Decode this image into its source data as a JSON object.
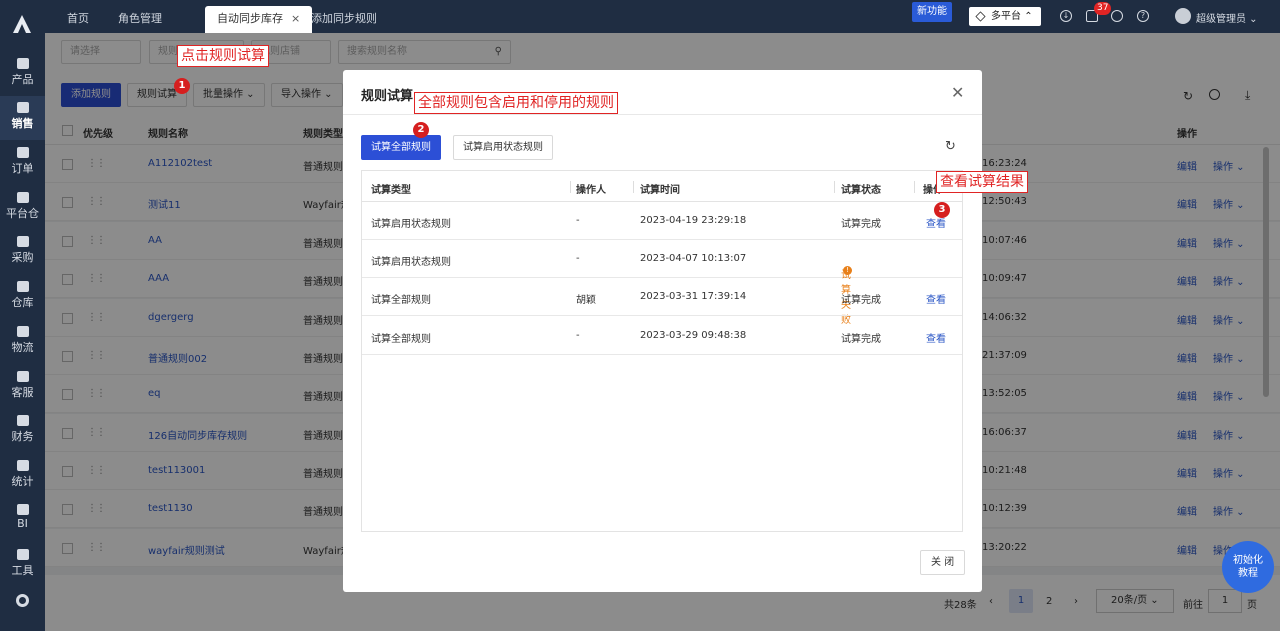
{
  "sidebar": {
    "items": [
      {
        "label": "产品"
      },
      {
        "label": "销售"
      },
      {
        "label": "订单"
      },
      {
        "label": "平台仓"
      },
      {
        "label": "采购"
      },
      {
        "label": "仓库"
      },
      {
        "label": "物流"
      },
      {
        "label": "客服"
      },
      {
        "label": "财务"
      },
      {
        "label": "统计"
      },
      {
        "label": "BI"
      },
      {
        "label": "工具"
      }
    ]
  },
  "topbar": {
    "tabs": [
      {
        "label": "首页"
      },
      {
        "label": "角色管理"
      },
      {
        "label": "自动同步库存"
      },
      {
        "label": "添加同步规则"
      }
    ],
    "new_feature": "新功能",
    "platform": "多平台",
    "notification_count": "37",
    "user": "超级管理员"
  },
  "filters": {
    "select1": "请选择",
    "select2": "规则类型",
    "select3": "规则店铺",
    "search_placeholder": "搜索规则名称"
  },
  "toolbar": {
    "add": "添加规则",
    "trial": "规则试算",
    "batch": "批量操作",
    "import": "导入操作"
  },
  "table": {
    "headers": {
      "priority": "优先级",
      "name": "规则名称",
      "type": "规则类型",
      "op": "操作"
    },
    "rows": [
      {
        "name": "A112102test",
        "type": "普通规则",
        "time": "16:23:24"
      },
      {
        "name": "测试11",
        "type": "Wayfair规",
        "time": "12:50:43"
      },
      {
        "name": "AA",
        "type": "普通规则",
        "time": "10:07:46"
      },
      {
        "name": "AAA",
        "type": "普通规则",
        "time": "10:09:47"
      },
      {
        "name": "dgergerg",
        "type": "普通规则",
        "time": "14:06:32"
      },
      {
        "name": "普通规则002",
        "type": "普通规则",
        "time": "21:37:09"
      },
      {
        "name": "eq",
        "type": "普通规则",
        "time": "13:52:05"
      },
      {
        "name": "126自动同步库存规则",
        "type": "普通规则",
        "time": "16:06:37"
      },
      {
        "name": "test113001",
        "type": "普通规则",
        "time": "10:21:48"
      },
      {
        "name": "test1130",
        "type": "普通规则",
        "time": "10:12:39"
      },
      {
        "name": "wayfair规则测试",
        "type": "Wayfair规",
        "time": "13:20:22"
      }
    ],
    "edit_label": "编辑",
    "op_label": "操作"
  },
  "pagination": {
    "total": "共28条",
    "page1": "1",
    "page2": "2",
    "page_size": "20条/页",
    "goto_label": "前往",
    "goto_value": "1",
    "page_suffix": "页"
  },
  "modal": {
    "title": "规则试算",
    "btn_all": "试算全部规则",
    "btn_enabled": "试算启用状态规则",
    "headers": {
      "type": "试算类型",
      "operator": "操作人",
      "time": "试算时间",
      "status": "试算状态",
      "op": "操作"
    },
    "rows": [
      {
        "type": "试算启用状态规则",
        "operator": "-",
        "time": "2023-04-19 23:29:18",
        "status": "试算完成",
        "action": "查看"
      },
      {
        "type": "试算启用状态规则",
        "operator": "-",
        "time": "2023-04-07 10:13:07",
        "status": "试算失败",
        "action": ""
      },
      {
        "type": "试算全部规则",
        "operator": "胡颖",
        "time": "2023-03-31 17:39:14",
        "status": "试算完成",
        "action": "查看"
      },
      {
        "type": "试算全部规则",
        "operator": "-",
        "time": "2023-03-29 09:48:38",
        "status": "试算完成",
        "action": "查看"
      }
    ],
    "close": "关 闭"
  },
  "annotations": {
    "a1": "点击规则试算",
    "a2": "全部规则包含启用和停用的规则",
    "a3": "查看试算结果",
    "n1": "1",
    "n2": "2",
    "n3": "3"
  },
  "tutorial": {
    "line1": "初始化",
    "line2": "教程"
  }
}
